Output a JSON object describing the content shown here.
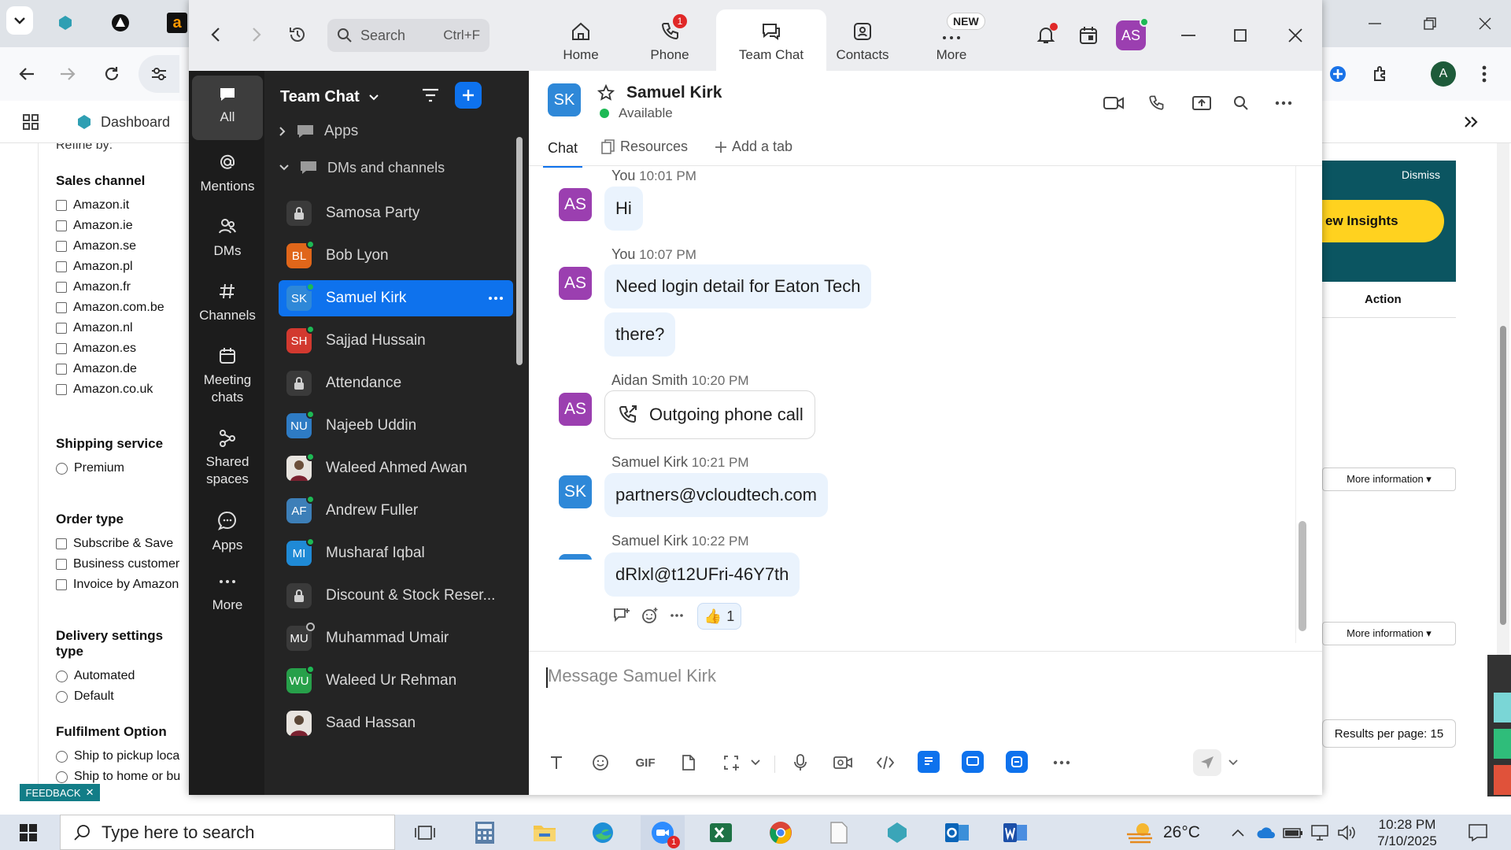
{
  "browser": {
    "dashboard_label": "Dashboard",
    "refine_title": "Refine by:",
    "sales_channel_title": "Sales channel",
    "sales_channels": [
      "Amazon.it",
      "Amazon.ie",
      "Amazon.se",
      "Amazon.pl",
      "Amazon.fr",
      "Amazon.com.be",
      "Amazon.nl",
      "Amazon.es",
      "Amazon.de",
      "Amazon.co.uk"
    ],
    "shipping_title": "Shipping service",
    "shipping_options": [
      "Premium"
    ],
    "order_type_title": "Order type",
    "order_types": [
      "Subscribe & Save",
      "Business customer",
      "Invoice by Amazon"
    ],
    "delivery_title": "Delivery settings type",
    "delivery_options": [
      "Automated",
      "Default"
    ],
    "fulfilment_title": "Fulfilment Option",
    "fulfilment_options": [
      "Ship to pickup loca",
      "Ship to home or bu"
    ],
    "dismiss_label": "Dismiss",
    "insights_label": "ew Insights",
    "action_header": "Action",
    "more_info_1": "More information ▾",
    "more_info_2": "More information ▾",
    "results_label": "Results per page: 15",
    "feedback_label": "FEEDBACK",
    "profile_initial": "A"
  },
  "zoom": {
    "search_label": "Search",
    "search_shortcut": "Ctrl+F",
    "nav_tabs": [
      {
        "label": "Home"
      },
      {
        "label": "Phone",
        "badge": "1"
      },
      {
        "label": "Team Chat"
      },
      {
        "label": "Contacts"
      },
      {
        "label": "More",
        "badge": "NEW"
      }
    ],
    "avatar_initials": "AS",
    "rail": [
      {
        "label": "All"
      },
      {
        "label": "Mentions"
      },
      {
        "label": "DMs"
      },
      {
        "label": "Channels"
      },
      {
        "label": "Meeting chats"
      },
      {
        "label": "Shared spaces"
      },
      {
        "label": "Apps"
      },
      {
        "label": "More"
      }
    ],
    "list_title": "Team Chat",
    "apps_section": "Apps",
    "dms_section": "DMs and channels",
    "channels": [
      {
        "name": "Samosa Party",
        "initials": "",
        "color": "#3a3a3a",
        "locked": true
      },
      {
        "name": "Bob Lyon",
        "initials": "BL",
        "color": "#e0661a",
        "status": "online"
      },
      {
        "name": "Samuel Kirk",
        "initials": "SK",
        "color": "#2e88d8",
        "status": "online",
        "active": true
      },
      {
        "name": "Sajjad Hussain",
        "initials": "SH",
        "color": "#d2392f",
        "status": "online"
      },
      {
        "name": "Attendance",
        "initials": "",
        "color": "#3a3a3a",
        "locked": true
      },
      {
        "name": "Najeeb Uddin",
        "initials": "NU",
        "color": "#2e7bc4",
        "status": "online"
      },
      {
        "name": "Waleed Ahmed Awan",
        "initials": "",
        "color": "#6b4f3a",
        "status": "online",
        "photo": true
      },
      {
        "name": "Andrew Fuller",
        "initials": "AF",
        "color": "#3d7fb8",
        "status": "online"
      },
      {
        "name": "Musharaf Iqbal",
        "initials": "MI",
        "color": "#1f8ad6",
        "status": "online"
      },
      {
        "name": "Discount & Stock Reser...",
        "initials": "",
        "color": "#3a3a3a",
        "locked": true
      },
      {
        "name": "Muhammad Umair",
        "initials": "MU",
        "color": "#3a3a3a",
        "status": "offline"
      },
      {
        "name": "Waleed Ur Rehman",
        "initials": "WU",
        "color": "#27a04a",
        "status": "online"
      },
      {
        "name": "Saad Hassan",
        "initials": "",
        "color": "#5a4636",
        "photo": true
      }
    ],
    "chat": {
      "contact_initials": "SK",
      "contact_name": "Samuel Kirk",
      "contact_status": "Available",
      "tabs": [
        "Chat",
        "Resources",
        "Add a tab"
      ],
      "messages": [
        {
          "sender": "You",
          "time": "10:01 PM",
          "initials": "AS",
          "text": [
            "Hi"
          ]
        },
        {
          "sender": "You",
          "time": "10:07 PM",
          "initials": "AS",
          "text": [
            "Need login detail for Eaton Tech",
            "there?"
          ]
        },
        {
          "sender": "Aidan Smith",
          "time": "10:20 PM",
          "initials": "AS",
          "text": [
            "Outgoing phone call"
          ]
        },
        {
          "sender": "Samuel Kirk",
          "time": "10:21 PM",
          "initials": "SK",
          "text": [
            "partners@vcloudtech.com"
          ]
        },
        {
          "sender": "Samuel Kirk",
          "time": "10:22 PM",
          "initials": "SK",
          "text": [
            "dRlxl@t12UFri-46Y7th"
          ]
        }
      ],
      "reaction_count": "1",
      "composer_placeholder": "Message Samuel Kirk",
      "gif_label": "GIF"
    }
  },
  "taskbar": {
    "search_placeholder": "Type here to search",
    "zoom_badge": "1",
    "temperature": "26°C",
    "time": "10:28 PM",
    "date": "7/10/2025"
  }
}
